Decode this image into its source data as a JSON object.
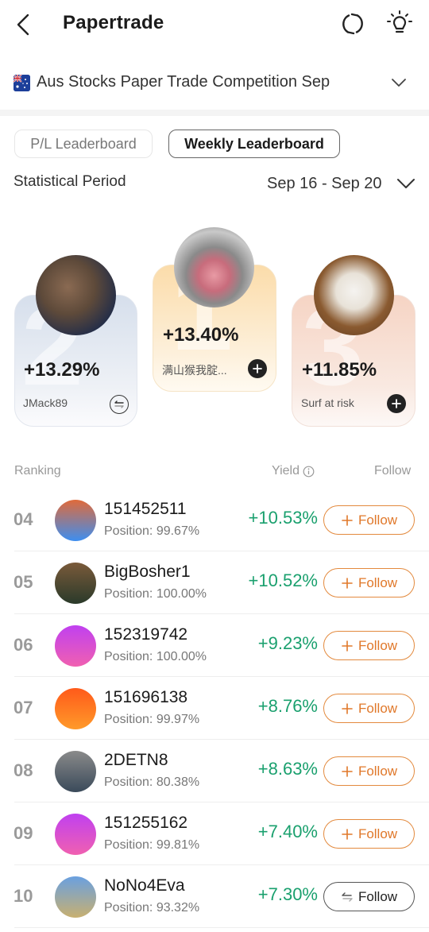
{
  "header": {
    "title": "Papertrade",
    "back_icon": "chevron-left-icon",
    "refresh_icon": "refresh-icon",
    "tips_icon": "lightbulb-icon"
  },
  "competition": {
    "flag": "australia-flag-icon",
    "name": "Aus Stocks Paper Trade Competition Sep"
  },
  "tabs": [
    {
      "label": "P/L Leaderboard",
      "active": false
    },
    {
      "label": "Weekly Leaderboard",
      "active": true
    }
  ],
  "period": {
    "label": "Statistical Period",
    "value": "Sep 16 - Sep 20"
  },
  "podium": [
    {
      "rank": "2",
      "yield": "+13.29%",
      "name": "JMack89",
      "action": "following"
    },
    {
      "rank": "1",
      "yield": "+13.40%",
      "name": "满山猴我腚...",
      "action": "add"
    },
    {
      "rank": "3",
      "yield": "+11.85%",
      "name": "Surf at risk",
      "action": "add"
    }
  ],
  "table": {
    "headers": {
      "ranking": "Ranking",
      "yield": "Yield",
      "follow": "Follow"
    },
    "rows": [
      {
        "rank": "04",
        "name": "151452511",
        "position": "Position:  99.67%",
        "yield": "+10.53%",
        "follow_label": "Follow",
        "following": false,
        "avatar_colors": [
          "#e06a3a",
          "#3d8ef0"
        ]
      },
      {
        "rank": "05",
        "name": "BigBosher1",
        "position": "Position:  100.00%",
        "yield": "+10.52%",
        "follow_label": "Follow",
        "following": false,
        "avatar_colors": [
          "#7a5a3a",
          "#2a3a2a"
        ]
      },
      {
        "rank": "06",
        "name": "152319742",
        "position": "Position:  100.00%",
        "yield": "+9.23%",
        "follow_label": "Follow",
        "following": false,
        "avatar_colors": [
          "#c040f0",
          "#f060b0"
        ]
      },
      {
        "rank": "07",
        "name": "151696138",
        "position": "Position:  99.97%",
        "yield": "+8.76%",
        "follow_label": "Follow",
        "following": false,
        "avatar_colors": [
          "#ff5a1a",
          "#ff9a2a"
        ]
      },
      {
        "rank": "08",
        "name": "2DETN8",
        "position": "Position:  80.38%",
        "yield": "+8.63%",
        "follow_label": "Follow",
        "following": false,
        "avatar_colors": [
          "#8a8a8a",
          "#3a4a5a"
        ]
      },
      {
        "rank": "09",
        "name": "151255162",
        "position": "Position:  99.81%",
        "yield": "+7.40%",
        "follow_label": "Follow",
        "following": false,
        "avatar_colors": [
          "#c040f0",
          "#f060b0"
        ]
      },
      {
        "rank": "10",
        "name": "NoNo4Eva",
        "position": "Position:  93.32%",
        "yield": "+7.30%",
        "follow_label": "Follow",
        "following": true,
        "avatar_colors": [
          "#6aa0e0",
          "#c8b070"
        ]
      }
    ]
  },
  "colors": {
    "positive": "#1aa06e",
    "follow_accent": "#e0782a"
  }
}
